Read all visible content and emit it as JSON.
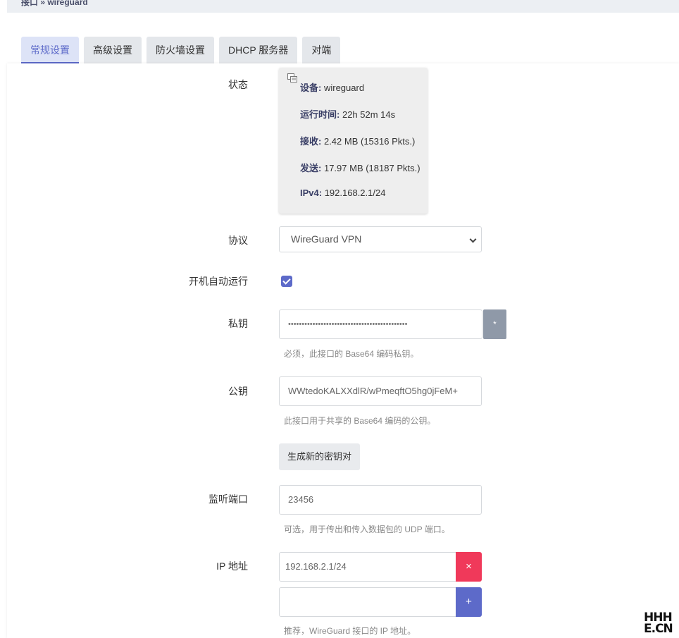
{
  "breadcrumb": "接口 » wireguard",
  "tabs": [
    {
      "label": "常规设置",
      "active": true
    },
    {
      "label": "高级设置"
    },
    {
      "label": "防火墙设置"
    },
    {
      "label": "DHCP 服务器"
    },
    {
      "label": "对端"
    }
  ],
  "status": {
    "label": "状态",
    "device_key": "设备:",
    "device_value": "wireguard",
    "uptime_key": "运行时间:",
    "uptime_value": "22h 52m 14s",
    "rx_key": "接收:",
    "rx_value": "2.42 MB (15316 Pkts.)",
    "tx_key": "发送:",
    "tx_value": "17.97 MB (18187 Pkts.)",
    "ipv4_key": "IPv4:",
    "ipv4_value": "192.168.2.1/24"
  },
  "protocol": {
    "label": "协议",
    "value": "WireGuard VPN"
  },
  "autostart": {
    "label": "开机自动运行",
    "checked": true
  },
  "private_key": {
    "label": "私钥",
    "value": "••••••••••••••••••••••••••••••••••••••••••••",
    "reveal_label": "*",
    "hint": "必须，此接口的 Base64 编码私钥。"
  },
  "public_key": {
    "label": "公钥",
    "value": "WWtedoKALXXdlR/wPmeqftO5hg0jFeM+",
    "hint": "此接口用于共享的 Base64 编码的公钥。"
  },
  "generate_button": "生成新的密钥对",
  "listen_port": {
    "label": "监听端口",
    "value": "23456",
    "hint": "可选，用于传出和传入数据包的 UDP 端口。"
  },
  "ip_address": {
    "label": "IP 地址",
    "value": "192.168.2.1/24",
    "new_value": "",
    "remove_label": "×",
    "add_label": "+",
    "hint": "推荐，WireGuard 接口的 IP 地址。"
  },
  "watermark": {
    "line1": "HHH",
    "line2": "E.CN"
  },
  "colors": {
    "accent": "#5d6ac9",
    "danger": "#f0395a",
    "muted_button": "#8f99a8"
  }
}
